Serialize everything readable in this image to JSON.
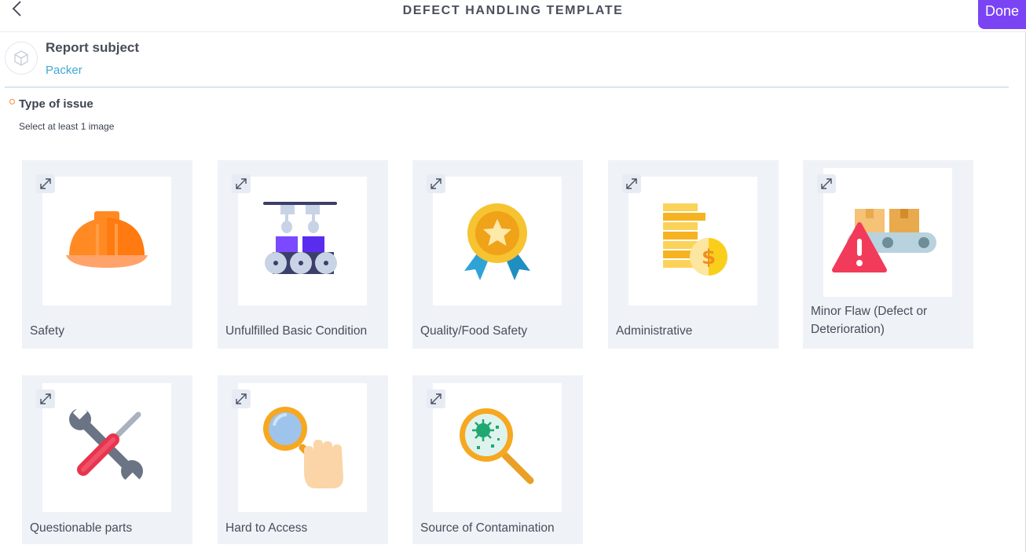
{
  "header": {
    "title": "DEFECT HANDLING TEMPLATE",
    "done_label": "Done",
    "back_icon": "chevron-left-icon"
  },
  "subject": {
    "label": "Report subject",
    "value": "Packer",
    "icon": "cube-icon"
  },
  "issue": {
    "title": "Type of issue",
    "subtitle": "Select at least 1 image",
    "options": [
      {
        "label": "Safety",
        "icon": "hard-hat-icon"
      },
      {
        "label": "Unfulfilled Basic Condition",
        "icon": "machine-icon"
      },
      {
        "label": "Quality/Food Safety",
        "icon": "award-medal-icon"
      },
      {
        "label": "Administrative",
        "icon": "coins-icon"
      },
      {
        "label": "Minor Flaw (Defect or Deterioration)",
        "icon": "conveyor-warning-icon"
      },
      {
        "label": "Questionable parts",
        "icon": "wrench-screwdriver-icon"
      },
      {
        "label": "Hard to Access",
        "icon": "magnifier-hand-icon"
      },
      {
        "label": "Source of Contamination",
        "icon": "magnifier-bacteria-icon"
      }
    ]
  },
  "colors": {
    "accent": "#7a44f5",
    "link": "#3fa8d8",
    "card_bg": "#eff2f7",
    "required": "#f08a3c"
  }
}
